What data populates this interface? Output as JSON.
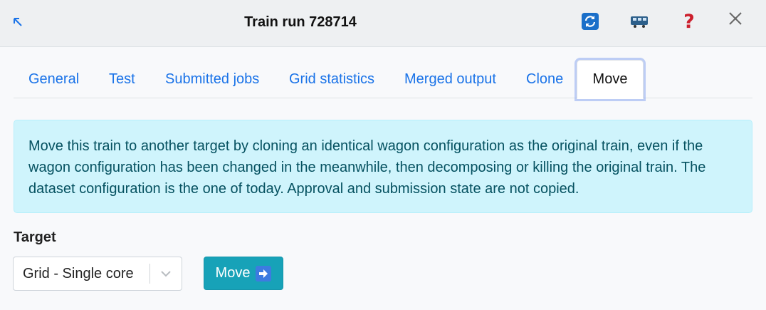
{
  "header": {
    "title": "Train run 728714",
    "icons": [
      "collapse-icon",
      "refresh-icon",
      "train-icon",
      "help-icon",
      "close-icon"
    ],
    "colors": {
      "refresh": "#1a6fc9",
      "train": "#2c5f8a",
      "help": "#cc1f2d",
      "close": "#666666"
    }
  },
  "tabs": [
    {
      "label": "General"
    },
    {
      "label": "Test"
    },
    {
      "label": "Submitted jobs"
    },
    {
      "label": "Grid statistics"
    },
    {
      "label": "Merged output"
    },
    {
      "label": "Clone"
    },
    {
      "label": "Move",
      "active": true
    }
  ],
  "alert": {
    "lines": [
      "Move this train to another target by cloning an identical wagon configuration as the original train, even if the",
      "wagon configuration has been changed in the meanwhile, then decomposing or killing the original train. The",
      "dataset configuration is the one of today. Approval and submission state are not copied."
    ]
  },
  "form": {
    "target_label": "Target",
    "target_value": "Grid - Single core",
    "move_label": "Move",
    "move_icon": "arrow-right-icon",
    "accent_color": "#17a2b8"
  }
}
